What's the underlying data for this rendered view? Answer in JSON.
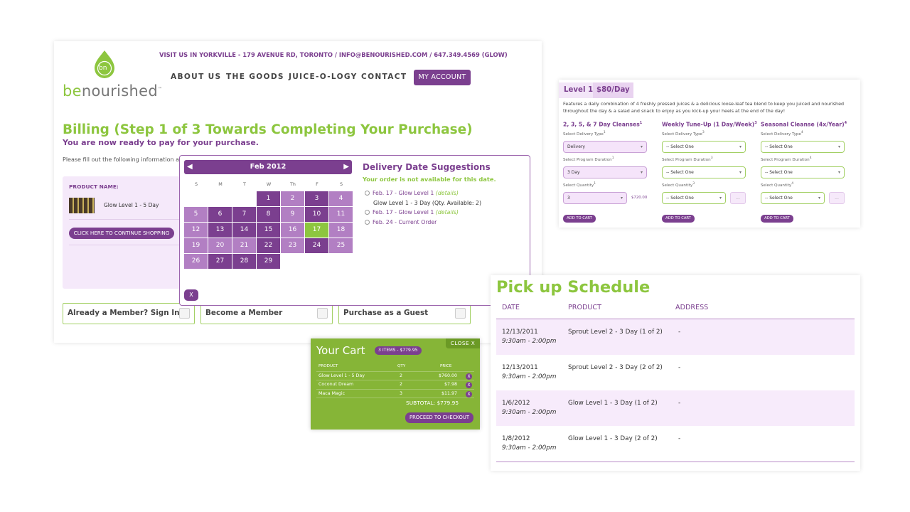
{
  "header": {
    "logo_prefix": "be",
    "logo_suffix": "nourished",
    "logo_mark": "bn",
    "tm": "™",
    "visit": "VISIT US IN YORKVILLE - 179 AVENUE RD, TORONTO / INFO@BENOURISHED.COM / 647.349.4569 (GLOW)",
    "nav": [
      "ABOUT US",
      "THE GOODS",
      "JUICE-O-LOGY",
      "CONTACT"
    ],
    "account": "MY ACCOUNT"
  },
  "billing": {
    "title": "Billing (Step 1 of 3 Towards Completing Your Purchase)",
    "subtitle": "You are now ready to pay for your purchase.",
    "fill": "Please fill out the following information and",
    "product_label": "PRODUCT NAME:",
    "product_name": "Glow Level 1 - 5 Day",
    "continue": "CLICK HERE TO CONTINUE SHOPPING",
    "options": [
      "Already a Member? Sign In",
      "Become a Member",
      "Purchase as a Guest"
    ]
  },
  "calendar": {
    "month": "Feb  2012",
    "prev_icon": "◀",
    "next_icon": "▶",
    "dow": [
      "S",
      "M",
      "T",
      "W",
      "Th",
      "F",
      "S"
    ],
    "close": "X",
    "colors": {
      "dark": "#7b3f8f",
      "light": "#b27fc3",
      "today": "#8dc63f"
    },
    "weeks": [
      [
        null,
        null,
        null,
        {
          "d": "1",
          "s": "dark"
        },
        {
          "d": "2",
          "s": "light"
        },
        {
          "d": "3",
          "s": "dark"
        },
        {
          "d": "4",
          "s": "light"
        }
      ],
      [
        {
          "d": "5",
          "s": "light"
        },
        {
          "d": "6",
          "s": "dark"
        },
        {
          "d": "7",
          "s": "dark"
        },
        {
          "d": "8",
          "s": "dark"
        },
        {
          "d": "9",
          "s": "light"
        },
        {
          "d": "10",
          "s": "dark"
        },
        {
          "d": "11",
          "s": "light"
        }
      ],
      [
        {
          "d": "12",
          "s": "light"
        },
        {
          "d": "13",
          "s": "dark"
        },
        {
          "d": "14",
          "s": "dark"
        },
        {
          "d": "15",
          "s": "dark"
        },
        {
          "d": "16",
          "s": "light"
        },
        {
          "d": "17",
          "s": "today"
        },
        {
          "d": "18",
          "s": "light"
        }
      ],
      [
        {
          "d": "19",
          "s": "light"
        },
        {
          "d": "20",
          "s": "light"
        },
        {
          "d": "21",
          "s": "light"
        },
        {
          "d": "22",
          "s": "dark"
        },
        {
          "d": "23",
          "s": "light"
        },
        {
          "d": "24",
          "s": "dark"
        },
        {
          "d": "25",
          "s": "light"
        }
      ],
      [
        {
          "d": "26",
          "s": "light"
        },
        {
          "d": "27",
          "s": "dark"
        },
        {
          "d": "28",
          "s": "dark"
        },
        {
          "d": "29",
          "s": "dark"
        },
        null,
        null,
        null
      ]
    ]
  },
  "delivery": {
    "title": "Delivery Date Suggestions",
    "notice": "Your order is not available for this date.",
    "details": "(details)",
    "s1": "Feb. 17 - Glow Level 1",
    "s1_note": "Glow Level 1 - 3 Day (Qty. Available: 2)",
    "s2": "Feb. 17 - Glow Level 1",
    "s3": "Feb. 24 - Current Order"
  },
  "cart": {
    "title": "Your Cart",
    "badge": "3 ITEMS - $779.95",
    "close": "CLOSE  X",
    "headers": [
      "PRODUCT",
      "QTY",
      "PRICE"
    ],
    "items": [
      {
        "product": "Glow Level 1 - 5 Day",
        "qty": "2",
        "price": "$760.00"
      },
      {
        "product": "Coconut Dream",
        "qty": "2",
        "price": "$7.98"
      },
      {
        "product": "Maca Magic",
        "qty": "3",
        "price": "$11.97"
      }
    ],
    "remove": "X",
    "subtotal": "SUBTOTAL: $779.95",
    "checkout": "PROCEED TO CHECKOUT"
  },
  "level": {
    "name": "Level 1",
    "price": "$80/Day",
    "desc": "Features a daily combination of 4 freshly pressed juices & a delicious loose-leaf tea blend to keep you juiced and nourished throughout the day & a salad and snack to enjoy as you kick-up your heels at the end of the day!",
    "lbl_type": "Select Delivery Type",
    "lbl_dur": "Select Program Duration",
    "lbl_qty": "Select Quantity",
    "add": "ADD TO CART",
    "more": "...",
    "caret": "▾",
    "columns": [
      {
        "title": "2, 3, 5, & 7 Day Cleanses",
        "sup": "1",
        "type": "Delivery",
        "dur": "3 Day",
        "qty": "3",
        "price": "$720.00"
      },
      {
        "title": "Weekly Tune-Up (1 Day/Week)",
        "sup": "3",
        "type": "-- Select One",
        "dur": "-- Select One",
        "qty": "-- Select One"
      },
      {
        "title": "Seasonal Cleanse (4x/Year)",
        "sup": "4",
        "type": "-- Select One",
        "dur": "-- Select One",
        "qty": "-- Select One"
      }
    ]
  },
  "schedule": {
    "title": "Pick up Schedule",
    "headers": [
      "DATE",
      "PRODUCT",
      "ADDRESS"
    ],
    "rows": [
      {
        "date": "12/13/2011",
        "time": "9:30am - 2:00pm",
        "product": "Sprout Level 2 - 3 Day (1 of 2)",
        "address": "-"
      },
      {
        "date": "12/13/2011",
        "time": "9:30am - 2:00pm",
        "product": "Sprout Level 2 - 3 Day (2 of 2)",
        "address": "-"
      },
      {
        "date": "1/6/2012",
        "time": "9:30am - 2:00pm",
        "product": "Glow Level 1 - 3 Day (1 of 2)",
        "address": "-"
      },
      {
        "date": "1/8/2012",
        "time": "9:30am - 2:00pm",
        "product": "Glow Level 1 - 3 Day (2 of 2)",
        "address": "-"
      }
    ]
  }
}
